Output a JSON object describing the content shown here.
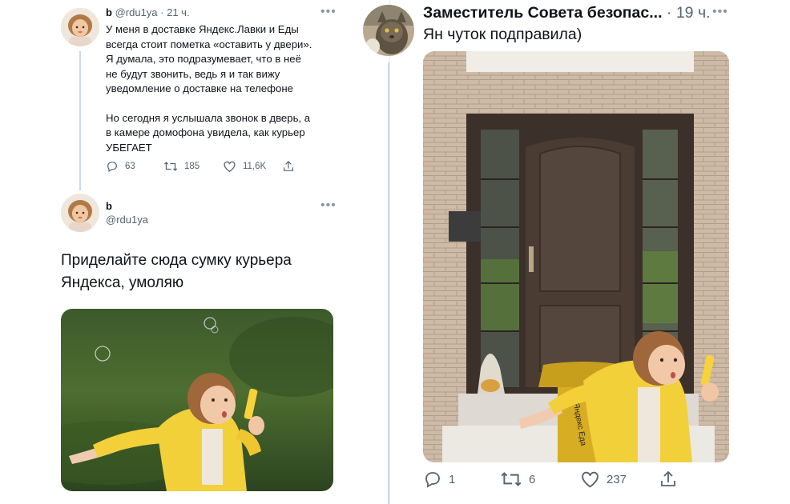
{
  "left": {
    "tweet1": {
      "name": "b",
      "handle": "@rdu1ya",
      "time": "· 21 ч.",
      "more": "•••",
      "text_lines": [
        "У меня в доставке Яндекс.Лавки и Еды",
        "всегда стоит пометка «оставить у двери».",
        "Я думала, это подразумевает, что в неё",
        "не будут звонить, ведь я и так вижу",
        "уведомление о доставке на телефоне",
        "",
        "Но сегодня я услышала звонок в дверь, а",
        "в камере домофона увидела, как курьер",
        "УБЕГАЕТ"
      ],
      "replies": "63",
      "retweets": "185",
      "likes": "11,6K"
    },
    "tweet2": {
      "name": "b",
      "handle": "@rdu1ya",
      "more": "•••",
      "text_lines": [
        "Приделайте сюда сумку курьера",
        "Яндекса, умоляю"
      ]
    }
  },
  "right": {
    "tweet": {
      "name": "Заместитель Совета безопас...",
      "time": "· 19 ч.",
      "more": "•••",
      "text": "Ян чуток подправила)",
      "replies": "1",
      "retweets": "6",
      "likes": "237",
      "bag_text": "Яндекс Еда"
    }
  },
  "icons": [
    "reply-icon",
    "retweet-icon",
    "like-icon",
    "share-icon"
  ]
}
